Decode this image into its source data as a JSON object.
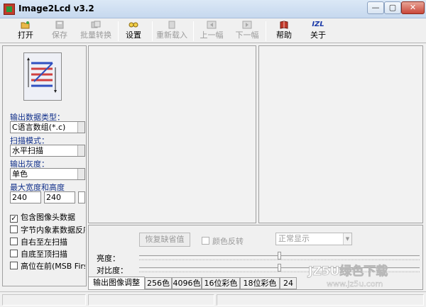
{
  "window": {
    "title": "Image2Lcd v3.2",
    "minimize": "—",
    "maximize": "▢",
    "close": "✕"
  },
  "toolbar": {
    "items": [
      {
        "label": "打开",
        "icon": "open-folder-icon",
        "disabled": false
      },
      {
        "label": "保存",
        "icon": "save-disk-icon",
        "disabled": true
      },
      {
        "label": "批量转换",
        "icon": "batch-convert-icon",
        "disabled": true
      },
      {
        "label": "设置",
        "icon": "settings-glasses-icon",
        "disabled": false
      },
      {
        "label": "重新载入",
        "icon": "reload-icon",
        "disabled": true
      },
      {
        "label": "上一幅",
        "icon": "previous-image-icon",
        "disabled": true
      },
      {
        "label": "下一幅",
        "icon": "next-image-icon",
        "disabled": true
      },
      {
        "label": "帮助",
        "icon": "help-book-icon",
        "disabled": false
      },
      {
        "label": "关于",
        "icon": "about-izl-icon",
        "disabled": false
      }
    ],
    "about_icon_text": "IZL"
  },
  "settings": {
    "output_type_label": "输出数据类型：",
    "output_type_value": "C语言数组(*.c)",
    "scan_mode_label": "扫描模式：",
    "scan_mode_value": "水平扫描",
    "gray_label": "输出灰度：",
    "gray_value": "单色",
    "max_size_label": "最大宽度和高度",
    "max_width": "240",
    "max_height": "240",
    "options": [
      {
        "label": "包含图像头数据",
        "checked": true
      },
      {
        "label": "字节内象素数据反序",
        "checked": false
      },
      {
        "label": "自右至左扫描",
        "checked": false
      },
      {
        "label": "自底至顶扫描",
        "checked": false
      },
      {
        "label": "高位在前(MSB First)",
        "checked": false
      }
    ]
  },
  "adjust": {
    "restore_label": "恢复缺省值",
    "invert_label": "颜色反转",
    "display_mode": "正常显示",
    "brightness_label": "亮度：",
    "contrast_label": "对比度：",
    "brightness_level": 0.5,
    "contrast_level": 0.5
  },
  "tabs": [
    {
      "label": "输出图像调整",
      "active": true
    },
    {
      "label": "256色",
      "active": false
    },
    {
      "label": "4096色",
      "active": false
    },
    {
      "label": "16位彩色",
      "active": false
    },
    {
      "label": "18位彩色",
      "active": false
    },
    {
      "label": "24",
      "active": false
    }
  ],
  "watermark": {
    "brand": "JZ5U绿色下载",
    "url": "www.jz5u.com"
  },
  "colors": {
    "label_blue": "#102f8a",
    "disabled_gray": "#9a9a9a"
  }
}
